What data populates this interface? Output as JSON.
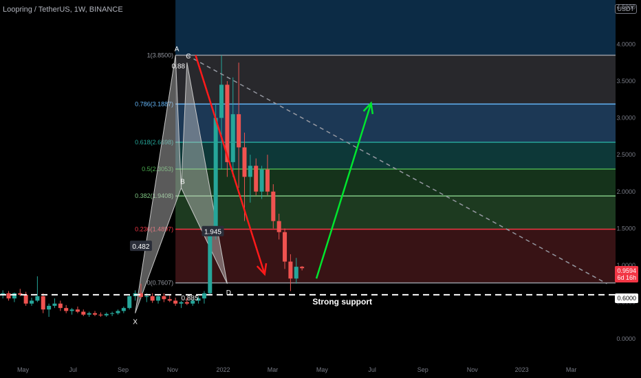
{
  "header": {
    "title": "Loopring / TetherUS, 1W, BINANCE",
    "currency": "USDT"
  },
  "price_label": {
    "value": "0.9594",
    "countdown": "6d 16h"
  },
  "support_label": "0.6000",
  "colors": {
    "up": "#26a69a",
    "down": "#ef5350",
    "fib_1": "#9598a1",
    "fib_786": "#64b5f6",
    "fib_618": "#26a69a",
    "fib_5": "#4caf50",
    "fib_382": "#81c784",
    "fib_236": "#f23645",
    "fib_0": "#9598a1",
    "arrow_down": "#ff1a1a",
    "arrow_up": "#00e62e",
    "harmonic": "#c8c8c8"
  },
  "chart_data": {
    "type": "candlestick",
    "title": "Loopring / TetherUS, 1W, BINANCE",
    "y_axis": {
      "ticks": [
        "4.5000",
        "4.0000",
        "3.5000",
        "3.0000",
        "2.5000",
        "2.0000",
        "1.5000",
        "1.0000",
        "0.5000",
        "0.0000"
      ],
      "tick_values": [
        4.5,
        4.0,
        3.5,
        3.0,
        2.5,
        2.0,
        1.5,
        1.0,
        0.5,
        0.0
      ],
      "ylim": [
        -0.25,
        4.6
      ]
    },
    "x_axis": {
      "ticks": [
        "May",
        "Jul",
        "Sep",
        "Nov",
        "2022",
        "Mar",
        "May",
        "Jul",
        "Sep",
        "Nov",
        "2023",
        "Mar"
      ],
      "tick_weeks": [
        0,
        8.7,
        17.4,
        26,
        34.8,
        43.4,
        52,
        60.7,
        69.5,
        78.1,
        86.7,
        95.3
      ],
      "xlim": [
        -4,
        103
      ]
    },
    "candles_start_week": -3.5,
    "candles": [
      [
        0.6,
        0.66,
        0.55,
        0.62
      ],
      [
        0.62,
        0.65,
        0.52,
        0.55
      ],
      [
        0.55,
        0.63,
        0.5,
        0.62
      ],
      [
        0.62,
        0.68,
        0.58,
        0.6
      ],
      [
        0.6,
        0.64,
        0.45,
        0.48
      ],
      [
        0.48,
        0.56,
        0.45,
        0.52
      ],
      [
        0.52,
        0.85,
        0.5,
        0.58
      ],
      [
        0.58,
        0.62,
        0.35,
        0.4
      ],
      [
        0.4,
        0.48,
        0.3,
        0.45
      ],
      [
        0.45,
        0.55,
        0.42,
        0.48
      ],
      [
        0.48,
        0.52,
        0.38,
        0.42
      ],
      [
        0.42,
        0.46,
        0.35,
        0.38
      ],
      [
        0.38,
        0.42,
        0.33,
        0.4
      ],
      [
        0.4,
        0.44,
        0.35,
        0.37
      ],
      [
        0.37,
        0.4,
        0.31,
        0.33
      ],
      [
        0.33,
        0.37,
        0.3,
        0.35
      ],
      [
        0.35,
        0.38,
        0.31,
        0.33
      ],
      [
        0.33,
        0.36,
        0.3,
        0.32
      ],
      [
        0.32,
        0.36,
        0.3,
        0.34
      ],
      [
        0.34,
        0.37,
        0.31,
        0.35
      ],
      [
        0.35,
        0.4,
        0.33,
        0.38
      ],
      [
        0.38,
        0.44,
        0.35,
        0.42
      ],
      [
        0.42,
        0.6,
        0.4,
        0.58
      ],
      [
        0.58,
        0.66,
        0.52,
        0.62
      ],
      [
        0.62,
        0.75,
        0.55,
        0.57
      ],
      [
        0.57,
        0.62,
        0.5,
        0.58
      ],
      [
        0.58,
        0.62,
        0.49,
        0.52
      ],
      [
        0.52,
        0.6,
        0.48,
        0.58
      ],
      [
        0.58,
        0.62,
        0.5,
        0.54
      ],
      [
        0.54,
        0.6,
        0.5,
        0.52
      ],
      [
        0.52,
        0.56,
        0.45,
        0.48
      ],
      [
        0.48,
        0.52,
        0.42,
        0.5
      ],
      [
        0.5,
        0.56,
        0.46,
        0.48
      ],
      [
        0.48,
        0.54,
        0.45,
        0.52
      ],
      [
        0.52,
        0.58,
        0.48,
        0.55
      ],
      [
        0.55,
        0.65,
        0.48,
        0.62
      ],
      [
        0.62,
        1.5,
        0.6,
        1.4
      ],
      [
        1.4,
        3.2,
        1.35,
        3.0
      ],
      [
        3.0,
        3.85,
        2.3,
        3.45
      ],
      [
        3.45,
        3.5,
        2.2,
        2.4
      ],
      [
        2.4,
        3.55,
        2.2,
        3.05
      ],
      [
        3.05,
        3.75,
        2.05,
        2.6
      ],
      [
        2.6,
        2.8,
        1.6,
        2.2
      ],
      [
        2.2,
        2.5,
        1.85,
        2.35
      ],
      [
        2.35,
        2.45,
        1.95,
        2.0
      ],
      [
        2.0,
        2.35,
        1.9,
        2.3
      ],
      [
        2.3,
        2.5,
        1.95,
        2.0
      ],
      [
        2.0,
        2.1,
        1.5,
        1.6
      ],
      [
        1.6,
        1.7,
        1.35,
        1.45
      ],
      [
        1.45,
        1.5,
        0.95,
        1.05
      ],
      [
        1.05,
        1.15,
        0.65,
        0.82
      ],
      [
        0.82,
        1.1,
        0.75,
        0.98
      ],
      [
        0.98,
        0.99,
        0.93,
        0.96
      ]
    ],
    "fib_levels": [
      {
        "ratio": 1,
        "value": 3.85,
        "label": "1(3.8500)"
      },
      {
        "ratio": 0.786,
        "value": 3.1887,
        "label": "0.786(3.1887)"
      },
      {
        "ratio": 0.618,
        "value": 2.6698,
        "label": "0.618(2.6698)"
      },
      {
        "ratio": 0.5,
        "value": 2.3053,
        "label": "0.5(2.3053)"
      },
      {
        "ratio": 0.382,
        "value": 1.9408,
        "label": "0.382(1.9408)"
      },
      {
        "ratio": 0.236,
        "value": 1.4897,
        "label": "0.236(1.4897)"
      },
      {
        "ratio": 0,
        "value": 0.7607,
        "label": "0(0.7607)"
      }
    ],
    "support": {
      "value": 0.6,
      "label": "Strong support"
    },
    "harmonic_points": [
      {
        "name": "X",
        "week": 19.5,
        "value": 0.35
      },
      {
        "name": "A",
        "week": 26.5,
        "value": 3.85
      },
      {
        "name": "B",
        "week": 27.5,
        "value": 2.05
      },
      {
        "name": "C",
        "week": 28.5,
        "value": 3.75
      },
      {
        "name": "D",
        "week": 35.5,
        "value": 0.75
      }
    ],
    "ratio_labels": [
      {
        "text": "0.482",
        "week": 20.5,
        "value": 1.25
      },
      {
        "text": "0.88",
        "week": 27.0,
        "value": 3.7
      },
      {
        "text": "1.945",
        "week": 33.0,
        "value": 1.45
      },
      {
        "text": "0.885",
        "week": 29.0,
        "value": 0.55
      }
    ],
    "trendline": {
      "from": {
        "week": 28.5,
        "value": 3.85
      },
      "to": {
        "week": 101.5,
        "value": 0.75
      }
    },
    "arrows": [
      {
        "direction": "down",
        "from": {
          "week": 30.0,
          "value": 3.85
        },
        "to": {
          "week": 42.0,
          "value": 0.88
        }
      },
      {
        "direction": "up",
        "from": {
          "week": 51.0,
          "value": 0.82
        },
        "to": {
          "week": 60.5,
          "value": 3.2
        }
      }
    ]
  }
}
